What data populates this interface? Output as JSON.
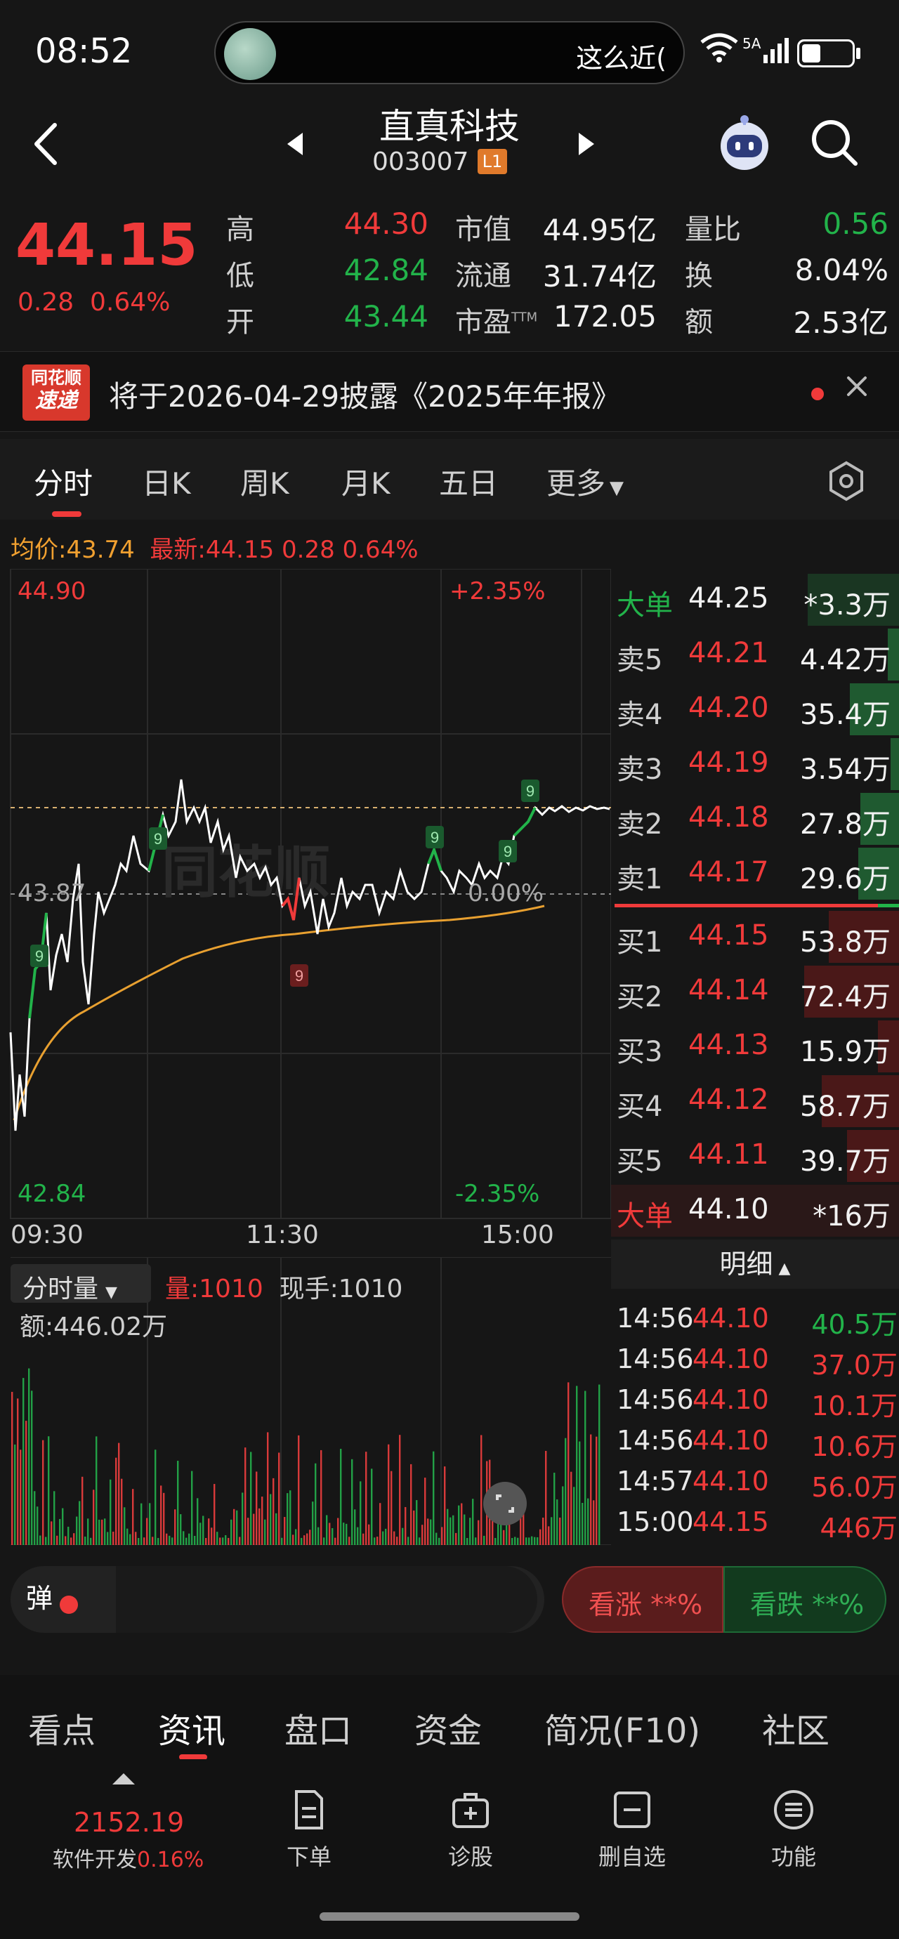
{
  "status_bar": {
    "time": "08:52",
    "island_text": "这么近(",
    "network": "5A"
  },
  "header": {
    "stock_name": "直真科技",
    "stock_code": "003007",
    "level": "L1"
  },
  "quote": {
    "price": "44.15",
    "change": "0.28",
    "change_pct": "0.64%",
    "high_label": "高",
    "high": "44.30",
    "low_label": "低",
    "low": "42.84",
    "open_label": "开",
    "open": "43.44",
    "mcap_label": "市值",
    "mcap": "44.95亿",
    "float_label": "流通",
    "float": "31.74亿",
    "pe_label": "市盈",
    "pe_sup": "TTM",
    "pe": "172.05",
    "vr_label": "量比",
    "vr": "0.56",
    "turnover_label": "换",
    "turnover": "8.04%",
    "amount_label": "额",
    "amount": "2.53亿"
  },
  "notice": {
    "logo_line1": "同花顺",
    "logo_line2": "速递",
    "text": "将于2026-04-29披露《2025年年报》"
  },
  "tabs": [
    "分时",
    "日K",
    "周K",
    "月K",
    "五日",
    "更多"
  ],
  "chart": {
    "avg_label": "均价:43.74",
    "latest_label": "最新:44.15 0.28 0.64%",
    "top_price": "44.90",
    "top_pct": "+2.35%",
    "mid_price": "43.87",
    "mid_pct": "0.00%",
    "bottom_price": "42.84",
    "bottom_pct": "-2.35%",
    "times": [
      "09:30",
      "11:30",
      "15:00"
    ],
    "markers": [
      "9",
      "9",
      "9",
      "9",
      "9",
      "9"
    ]
  },
  "orderbook": {
    "big_sell": {
      "label": "大单",
      "price": "44.25",
      "vol": "*3.3万"
    },
    "asks": [
      {
        "label": "卖5",
        "price": "44.21",
        "vol": "4.42万"
      },
      {
        "label": "卖4",
        "price": "44.20",
        "vol": "35.4万"
      },
      {
        "label": "卖3",
        "price": "44.19",
        "vol": "3.54万"
      },
      {
        "label": "卖2",
        "price": "44.18",
        "vol": "27.8万"
      },
      {
        "label": "卖1",
        "price": "44.17",
        "vol": "29.6万"
      }
    ],
    "bids": [
      {
        "label": "买1",
        "price": "44.15",
        "vol": "53.8万"
      },
      {
        "label": "买2",
        "price": "44.14",
        "vol": "72.4万"
      },
      {
        "label": "买3",
        "price": "44.13",
        "vol": "15.9万"
      },
      {
        "label": "买4",
        "price": "44.12",
        "vol": "58.7万"
      },
      {
        "label": "买5",
        "price": "44.11",
        "vol": "39.7万"
      }
    ],
    "big_buy": {
      "label": "大单",
      "price": "44.10",
      "vol": "*16万"
    }
  },
  "volume": {
    "selector": "分时量",
    "amount": "额:446.02万",
    "vol_label": "量:1010",
    "hand_label": "现手:1010"
  },
  "detail": {
    "title": "明细",
    "rows": [
      {
        "time": "14:56",
        "price": "44.10",
        "vol": "40.5万",
        "dir": "sell"
      },
      {
        "time": "14:56",
        "price": "44.10",
        "vol": "37.0万",
        "dir": "buy"
      },
      {
        "time": "14:56",
        "price": "44.10",
        "vol": "10.1万",
        "dir": "buy"
      },
      {
        "time": "14:56",
        "price": "44.10",
        "vol": "10.6万",
        "dir": "buy"
      },
      {
        "time": "14:57",
        "price": "44.10",
        "vol": "56.0万",
        "dir": "buy"
      },
      {
        "time": "15:00",
        "price": "44.15",
        "vol": "446万",
        "dir": "buy"
      }
    ]
  },
  "barrage": {
    "icon": "弹",
    "placeholder": ""
  },
  "vote": {
    "up": "看涨 **%",
    "down": "看跌 **%"
  },
  "section_tabs": [
    "看点",
    "资讯",
    "盘口",
    "资金",
    "简况(F10)",
    "社区"
  ],
  "bottom": {
    "index_value": "2152.19",
    "index_name": "软件开发",
    "index_pct": "0.16%",
    "items": [
      "下单",
      "诊股",
      "删自选",
      "功能"
    ]
  }
}
